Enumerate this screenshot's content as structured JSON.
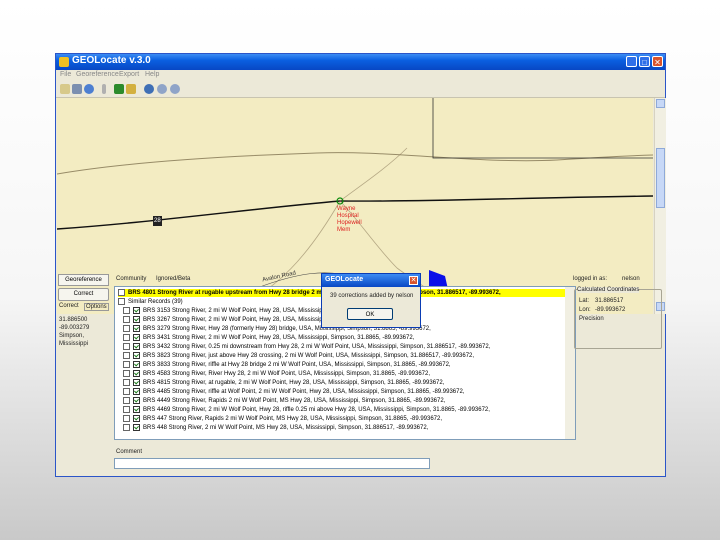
{
  "window": {
    "title": "GEOLocate v.3.0",
    "min": "_",
    "max": "□",
    "close": "✕"
  },
  "menubar": [
    "File",
    "Georeference",
    "Export",
    "Help"
  ],
  "map": {
    "marker_text": "Wayne Hospital Hopewell Mem",
    "road_label": "Avalon Road",
    "route_label": "28"
  },
  "left_panel": {
    "georeference_label": "Georeference",
    "correct_button": "Correct",
    "tab_correct": "Correct",
    "tab_options": "Options",
    "coords": [
      "31.886500",
      "-89.003279",
      "Simpson,",
      "Mississippi"
    ]
  },
  "tabs": {
    "community": "Community",
    "interest": "Ignored/Beta"
  },
  "list": {
    "header": "BRS 4801 Strong River at rugable upstream from Hwy 28 bridge 2 mi W of Wolf Point, Mississippi, Simpson, 31.886517, -89.993672,",
    "group": "Similar Records (39)",
    "rows": [
      "BRS 3153 Strong River, 2 mi W Wolf Point, Hwy 28, USA, Mississippi, Simpson, 31.8865, -89.993672,",
      "BRS 3267 Strong River, 2 mi W Wolf Point, Hwy 28, USA, Mississippi, Simpson, 31.8865, -89.993672,",
      "BRS 3279 Strong River, Hwy 28 (formerly Hwy 28) bridge, USA, Mississippi, Simpson, 31.8865, -89.993672,",
      "BRS 3431 Strong River, 2 mi W Wolf Point, Hwy 28, USA, Mississippi, Simpson, 31.8865, -89.993672,",
      "BRS 3432 Strong River, 0.25 mi downstream from Hwy 28, 2 mi W Wolf Point, USA, Mississippi, Simpson, 31.886517, -89.993672,",
      "BRS 3823 Strong River, just above Hwy 28 crossing, 2 mi W Wolf Point, USA, Mississippi, Simpson, 31.886517, -89.993672,",
      "BRS 3833 Strong River, riffle at Hwy 28 bridge 2 mi W Wolf Point, USA, Mississippi, Simpson, 31.8865, -89.993672,",
      "BRS 4583 Strong River, River Hwy 28, 2 mi W Wolf Point, USA, Mississippi, Simpson, 31.8865, -89.993672,",
      "BRS 4815 Strong River, at rugable, 2 mi W Wolf Point, Hwy 28, USA, Mississippi, Simpson, 31.8865, -89.993672,",
      "BRS 4485 Strong River, riffle at Wolf Point, 2 mi W Wolf Point, Hwy 28, USA, Mississippi, Simpson, 31.8865, -89.993672,",
      "BRS 4449 Strong River, Rapids 2 mi W Wolf Point, MS Hwy 28, USA, Mississippi, Simpson, 31.8865, -89.993672,",
      "BRS 4469 Strong River, 2 mi W Wolf Point, Hwy 28, riffle 0.25 mi above Hwy 28, USA, Mississippi, Simpson, 31.8865, -89.993672,",
      "BRS 447 Strong River, Rapids 2 mi W Wolf Point, MS Hwy 28, USA, Mississippi, Simpson, 31.8865, -89.993672,",
      "BRS 448 Strong River, 2 mi W Wolf Point, MS Hwy 28, USA, Mississippi, Simpson, 31.886517, -89.993672,"
    ]
  },
  "comment": {
    "label": "Comment",
    "value": ""
  },
  "right_panel": {
    "logged_in_label": "logged in as:",
    "user": "nelson",
    "calc_title": "Calculated Coordinates",
    "lat_label": "Lat:",
    "lat_value": "31.886517",
    "lon_label": "Lon:",
    "lon_value": "-89.993672",
    "precision_label": "Precision"
  },
  "dialog": {
    "title": "GEOLocate",
    "message": "39 corrections added by nelson",
    "ok": "OK"
  },
  "colors": {
    "titlebar": "#0a5fe0",
    "selected_row": "#ffff00",
    "water_feature": "#0000ff",
    "desktop": "#ece9d8"
  }
}
